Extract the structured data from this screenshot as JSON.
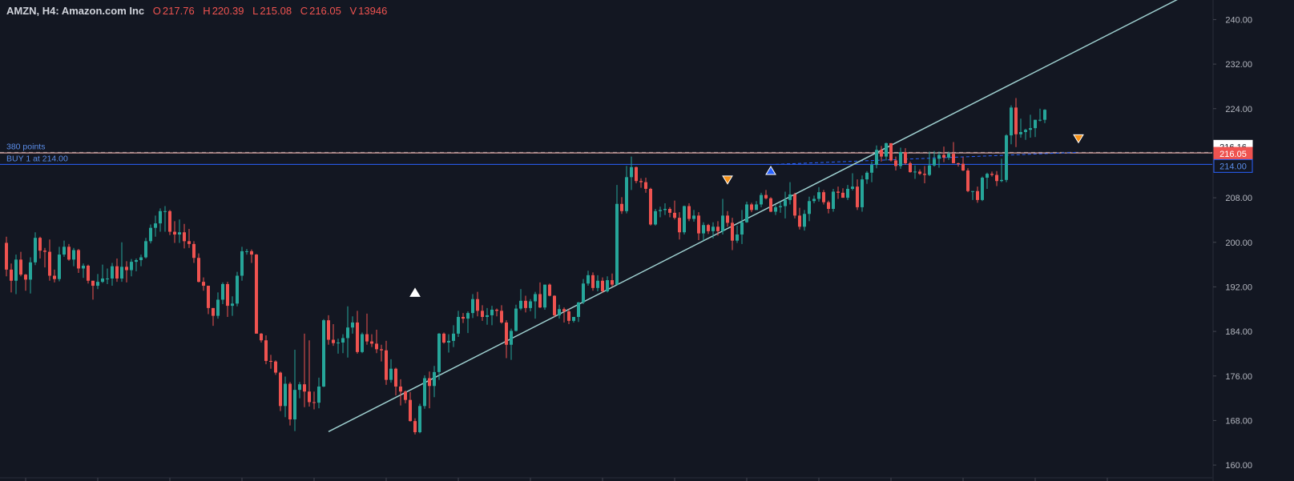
{
  "legend": {
    "symbol": "AMZN, H4: Amazon.com Inc",
    "o_label": "O",
    "o": "217.76",
    "h_label": "H",
    "h": "220.39",
    "l_label": "L",
    "l": "215.08",
    "c_label": "C",
    "c": "216.05",
    "v_label": "V",
    "v": "13946"
  },
  "colors": {
    "background": "#131722",
    "up": "#26a69a",
    "down": "#ef5350",
    "trendline": "#9ecfcf",
    "buy_line": "#2962ff",
    "last_price": "#ef5350",
    "text": "#d1d4dc",
    "axis_text": "#b2b5be",
    "signal_down": "#f7931a",
    "signal_up": "#2962ff"
  },
  "horizontal_lines": {
    "target": {
      "label": "380 points",
      "price": 216.16,
      "tag": "216.16"
    },
    "last": {
      "price": 216.05,
      "tag": "216.05"
    },
    "buy": {
      "label": "BUY 1 at 214.00",
      "price": 214.0,
      "tag": "214.00"
    }
  },
  "chart_data": {
    "type": "candlestick",
    "symbol": "AMZN",
    "timeframe": "H4",
    "ylim": [
      158,
      241.5
    ],
    "y_ticks": [
      "240.00",
      "232.00",
      "224.00",
      "216.00",
      "208.00",
      "200.00",
      "192.00",
      "184.00",
      "176.00",
      "168.00",
      "160.00"
    ],
    "bar_count": 226,
    "candles": [
      [
        199.9,
        201.0,
        193.9,
        195.1
      ],
      [
        195.1,
        196.2,
        191.0,
        193.1
      ],
      [
        193.1,
        197.8,
        190.7,
        196.9
      ],
      [
        196.9,
        198.3,
        193.9,
        194.2
      ],
      [
        194.2,
        194.3,
        191.3,
        193.3
      ],
      [
        193.3,
        197.3,
        190.8,
        196.4
      ],
      [
        196.4,
        201.8,
        195.9,
        200.8
      ],
      [
        200.8,
        201.0,
        197.1,
        198.5
      ],
      [
        198.5,
        199.0,
        195.5,
        198.3
      ],
      [
        198.3,
        200.5,
        193.1,
        194.0
      ],
      [
        194.0,
        195.1,
        192.8,
        193.4
      ],
      [
        193.4,
        199.2,
        193.0,
        197.8
      ],
      [
        197.8,
        200.3,
        197.4,
        199.2
      ],
      [
        199.2,
        199.7,
        196.7,
        196.9
      ],
      [
        196.9,
        199.0,
        195.7,
        198.6
      ],
      [
        198.6,
        198.8,
        194.5,
        195.3
      ],
      [
        195.3,
        196.2,
        193.6,
        195.8
      ],
      [
        195.8,
        196.0,
        192.6,
        193.1
      ],
      [
        193.1,
        193.1,
        189.7,
        192.2
      ],
      [
        192.2,
        194.3,
        191.6,
        192.9
      ],
      [
        192.9,
        196.0,
        192.7,
        193.5
      ],
      [
        193.5,
        195.3,
        192.5,
        193.5
      ],
      [
        193.5,
        196.3,
        192.2,
        195.7
      ],
      [
        195.7,
        197.1,
        192.9,
        193.5
      ],
      [
        193.5,
        200.0,
        192.9,
        195.6
      ],
      [
        195.6,
        196.6,
        192.8,
        195.0
      ],
      [
        195.0,
        197.0,
        193.9,
        196.5
      ],
      [
        196.5,
        197.1,
        194.8,
        196.8
      ],
      [
        196.8,
        197.8,
        195.7,
        197.3
      ],
      [
        197.3,
        200.8,
        197.1,
        200.2
      ],
      [
        200.2,
        203.2,
        199.8,
        202.6
      ],
      [
        202.6,
        204.8,
        201.0,
        203.4
      ],
      [
        203.4,
        206.1,
        201.9,
        205.6
      ],
      [
        205.6,
        206.5,
        201.9,
        205.6
      ],
      [
        205.6,
        205.8,
        201.3,
        201.9
      ],
      [
        201.9,
        203.8,
        199.9,
        201.4
      ],
      [
        201.4,
        204.1,
        199.9,
        201.8
      ],
      [
        201.8,
        203.3,
        198.9,
        200.2
      ],
      [
        200.2,
        202.4,
        199.0,
        199.7
      ],
      [
        199.7,
        200.2,
        196.3,
        197.2
      ],
      [
        197.2,
        198.0,
        192.8,
        192.9
      ],
      [
        192.9,
        193.7,
        191.3,
        192.2
      ],
      [
        192.2,
        192.2,
        187.1,
        188.2
      ],
      [
        188.2,
        188.2,
        185.0,
        186.8
      ],
      [
        186.8,
        191.0,
        186.3,
        189.7
      ],
      [
        189.7,
        192.8,
        188.9,
        192.5
      ],
      [
        192.5,
        192.9,
        186.6,
        188.6
      ],
      [
        188.6,
        190.3,
        186.8,
        189.0
      ],
      [
        189.0,
        194.7,
        188.5,
        194.0
      ],
      [
        194.0,
        199.2,
        193.1,
        198.4
      ],
      [
        198.4,
        198.8,
        197.8,
        198.4
      ],
      [
        198.4,
        198.7,
        196.3,
        197.8
      ],
      [
        197.8,
        197.9,
        183.6,
        183.6
      ],
      [
        183.6,
        183.7,
        182.0,
        182.4
      ],
      [
        182.4,
        183.3,
        178.1,
        178.7
      ],
      [
        178.7,
        179.8,
        177.3,
        178.6
      ],
      [
        178.6,
        178.8,
        176.2,
        176.6
      ],
      [
        176.6,
        176.8,
        169.7,
        170.6
      ],
      [
        170.6,
        175.9,
        168.6,
        174.6
      ],
      [
        174.6,
        174.9,
        167.1,
        168.2
      ],
      [
        168.2,
        180.7,
        166.1,
        173.5
      ],
      [
        173.5,
        174.9,
        172.0,
        174.5
      ],
      [
        174.5,
        183.6,
        170.4,
        173.2
      ],
      [
        173.2,
        182.4,
        170.5,
        171.3
      ],
      [
        171.3,
        173.2,
        170.0,
        171.2
      ],
      [
        171.2,
        175.7,
        170.2,
        174.1
      ],
      [
        174.1,
        186.2,
        174.0,
        186.0
      ],
      [
        186.0,
        186.9,
        181.6,
        182.5
      ],
      [
        182.5,
        185.3,
        181.4,
        181.9
      ],
      [
        181.9,
        182.7,
        180.0,
        182.0
      ],
      [
        182.0,
        183.5,
        180.1,
        182.8
      ],
      [
        182.8,
        188.5,
        179.3,
        184.7
      ],
      [
        184.7,
        186.7,
        183.6,
        185.6
      ],
      [
        185.6,
        187.7,
        180.0,
        180.3
      ],
      [
        180.3,
        183.8,
        180.1,
        183.5
      ],
      [
        183.5,
        187.2,
        181.6,
        182.2
      ],
      [
        182.2,
        183.5,
        181.2,
        181.8
      ],
      [
        181.8,
        184.3,
        180.1,
        180.8
      ],
      [
        180.8,
        181.6,
        178.6,
        180.6
      ],
      [
        180.6,
        182.3,
        174.4,
        175.3
      ],
      [
        175.3,
        179.0,
        174.8,
        177.3
      ],
      [
        177.3,
        177.5,
        172.5,
        174.1
      ],
      [
        174.1,
        175.4,
        170.7,
        173.2
      ],
      [
        173.2,
        173.4,
        171.1,
        171.7
      ],
      [
        171.7,
        173.1,
        167.8,
        167.9
      ],
      [
        167.9,
        168.4,
        165.5,
        165.9
      ],
      [
        165.9,
        171.0,
        165.7,
        170.6
      ],
      [
        170.6,
        176.1,
        170.1,
        175.6
      ],
      [
        175.6,
        176.8,
        170.2,
        174.2
      ],
      [
        174.2,
        177.8,
        172.2,
        176.7
      ],
      [
        176.7,
        183.7,
        175.3,
        183.6
      ],
      [
        183.6,
        183.8,
        181.8,
        182.0
      ],
      [
        182.0,
        183.5,
        180.2,
        182.3
      ],
      [
        182.3,
        185.1,
        181.2,
        183.6
      ],
      [
        183.6,
        187.7,
        183.0,
        186.6
      ],
      [
        186.6,
        187.3,
        185.5,
        186.3
      ],
      [
        186.3,
        187.6,
        183.7,
        187.3
      ],
      [
        187.3,
        190.7,
        186.4,
        189.8
      ],
      [
        189.8,
        191.1,
        186.7,
        187.7
      ],
      [
        187.7,
        188.7,
        185.9,
        186.6
      ],
      [
        186.6,
        188.2,
        185.2,
        186.9
      ],
      [
        186.9,
        188.6,
        185.1,
        187.9
      ],
      [
        187.9,
        188.1,
        186.7,
        187.7
      ],
      [
        187.7,
        188.7,
        185.4,
        185.6
      ],
      [
        185.6,
        186.0,
        179.2,
        181.6
      ],
      [
        181.6,
        184.5,
        178.9,
        184.1
      ],
      [
        184.1,
        188.8,
        184.0,
        188.1
      ],
      [
        188.1,
        191.6,
        187.8,
        189.5
      ],
      [
        189.5,
        190.4,
        187.4,
        188.2
      ],
      [
        188.2,
        189.8,
        187.6,
        189.4
      ],
      [
        189.4,
        191.1,
        186.3,
        190.7
      ],
      [
        190.7,
        192.8,
        188.2,
        188.3
      ],
      [
        188.3,
        192.4,
        187.9,
        192.4
      ],
      [
        192.4,
        192.6,
        190.3,
        190.4
      ],
      [
        190.4,
        190.5,
        186.6,
        186.9
      ],
      [
        186.9,
        188.8,
        186.3,
        188.0
      ],
      [
        188.0,
        188.3,
        185.6,
        187.6
      ],
      [
        187.6,
        188.1,
        185.3,
        185.9
      ],
      [
        185.9,
        186.6,
        185.6,
        186.6
      ],
      [
        186.6,
        189.3,
        185.7,
        189.2
      ],
      [
        189.2,
        193.4,
        188.9,
        192.6
      ],
      [
        192.6,
        194.9,
        192.2,
        194.1
      ],
      [
        194.1,
        194.6,
        191.3,
        191.8
      ],
      [
        191.8,
        194.1,
        191.2,
        193.1
      ],
      [
        193.1,
        193.7,
        190.9,
        191.2
      ],
      [
        191.2,
        193.9,
        191.0,
        193.2
      ],
      [
        193.2,
        194.4,
        192.0,
        192.4
      ],
      [
        192.4,
        210.3,
        205.3,
        206.9
      ],
      [
        206.9,
        208.1,
        205.1,
        205.6
      ],
      [
        205.6,
        213.7,
        205.2,
        211.7
      ],
      [
        211.7,
        215.4,
        209.4,
        213.5
      ],
      [
        213.5,
        213.6,
        210.6,
        211.0
      ],
      [
        211.0,
        211.5,
        209.8,
        210.8
      ],
      [
        210.8,
        211.6,
        208.9,
        209.6
      ],
      [
        209.6,
        209.8,
        203.0,
        203.2
      ],
      [
        203.2,
        206.0,
        203.0,
        205.6
      ],
      [
        205.6,
        206.4,
        204.5,
        205.8
      ],
      [
        205.8,
        207.0,
        204.9,
        206.0
      ],
      [
        206.0,
        206.3,
        204.5,
        205.3
      ],
      [
        205.3,
        207.5,
        204.1,
        204.4
      ],
      [
        204.4,
        205.4,
        200.5,
        201.8
      ],
      [
        201.8,
        206.6,
        201.4,
        206.5
      ],
      [
        206.5,
        207.0,
        203.8,
        204.2
      ],
      [
        204.2,
        205.8,
        203.7,
        204.8
      ],
      [
        204.8,
        205.4,
        200.4,
        201.6
      ],
      [
        201.6,
        203.6,
        200.3,
        203.1
      ],
      [
        203.1,
        203.3,
        201.5,
        202.0
      ],
      [
        202.0,
        203.6,
        200.7,
        202.8
      ],
      [
        202.8,
        203.8,
        201.2,
        202.0
      ],
      [
        202.0,
        207.8,
        201.4,
        204.8
      ],
      [
        204.8,
        205.6,
        202.8,
        203.5
      ],
      [
        203.5,
        204.4,
        198.6,
        200.3
      ],
      [
        200.3,
        203.0,
        199.9,
        201.4
      ],
      [
        201.4,
        205.8,
        199.7,
        203.6
      ],
      [
        203.6,
        207.3,
        203.5,
        206.8
      ],
      [
        206.8,
        207.1,
        205.4,
        205.8
      ],
      [
        205.8,
        207.4,
        206.0,
        206.8
      ],
      [
        206.8,
        208.9,
        206.3,
        208.5
      ],
      [
        208.5,
        209.4,
        207.7,
        207.9
      ],
      [
        207.9,
        208.1,
        205.4,
        205.5
      ],
      [
        205.5,
        206.7,
        204.9,
        206.3
      ],
      [
        206.3,
        207.3,
        205.3,
        206.5
      ],
      [
        206.5,
        209.1,
        204.3,
        207.6
      ],
      [
        207.6,
        210.8,
        206.8,
        208.6
      ],
      [
        208.6,
        208.9,
        204.3,
        204.8
      ],
      [
        204.8,
        206.2,
        202.3,
        202.8
      ],
      [
        202.8,
        205.8,
        202.1,
        205.1
      ],
      [
        205.1,
        208.2,
        203.8,
        207.4
      ],
      [
        207.4,
        208.4,
        207.0,
        207.8
      ],
      [
        207.8,
        209.9,
        207.3,
        209.0
      ],
      [
        209.0,
        209.4,
        206.8,
        207.2
      ],
      [
        207.2,
        207.5,
        205.2,
        206.0
      ],
      [
        206.0,
        209.6,
        205.5,
        209.1
      ],
      [
        209.1,
        210.0,
        207.8,
        208.9
      ],
      [
        208.9,
        209.7,
        208.0,
        208.0
      ],
      [
        208.0,
        210.3,
        207.6,
        209.6
      ],
      [
        209.6,
        212.4,
        209.3,
        210.0
      ],
      [
        210.0,
        211.3,
        205.8,
        206.3
      ],
      [
        206.3,
        212.0,
        205.5,
        211.3
      ],
      [
        211.3,
        212.8,
        210.5,
        212.5
      ],
      [
        212.5,
        214.5,
        210.8,
        213.9
      ],
      [
        213.9,
        217.4,
        213.3,
        216.6
      ],
      [
        216.6,
        217.3,
        214.5,
        215.4
      ],
      [
        215.4,
        217.9,
        214.7,
        217.8
      ],
      [
        217.8,
        217.8,
        214.5,
        214.7
      ],
      [
        214.7,
        215.4,
        212.9,
        213.7
      ],
      [
        213.7,
        217.0,
        213.2,
        216.2
      ],
      [
        216.2,
        216.9,
        213.9,
        214.2
      ],
      [
        214.2,
        214.5,
        212.5,
        212.6
      ],
      [
        212.6,
        213.8,
        211.4,
        212.7
      ],
      [
        212.7,
        213.1,
        212.1,
        212.3
      ],
      [
        212.3,
        213.7,
        210.6,
        212.1
      ],
      [
        212.1,
        216.3,
        211.9,
        213.8
      ],
      [
        213.8,
        216.4,
        213.6,
        215.0
      ],
      [
        215.0,
        216.3,
        213.4,
        215.7
      ],
      [
        215.7,
        217.2,
        214.4,
        215.2
      ],
      [
        215.2,
        216.3,
        214.8,
        215.9
      ],
      [
        215.9,
        218.0,
        215.4,
        214.2
      ],
      [
        214.2,
        214.3,
        213.6,
        214.1
      ],
      [
        214.1,
        215.3,
        212.8,
        212.9
      ],
      [
        212.9,
        213.3,
        209.0,
        209.2
      ],
      [
        209.2,
        209.2,
        207.6,
        209.2
      ],
      [
        209.2,
        210.0,
        207.1,
        207.6
      ],
      [
        207.6,
        211.8,
        207.4,
        211.6
      ],
      [
        211.6,
        212.5,
        209.6,
        212.3
      ],
      [
        212.3,
        212.7,
        211.8,
        212.1
      ],
      [
        212.1,
        212.8,
        210.1,
        211.0
      ],
      [
        211.0,
        215.0,
        210.8,
        211.2
      ],
      [
        211.2,
        219.4,
        210.8,
        219.2
      ],
      [
        219.2,
        224.6,
        217.6,
        224.2
      ],
      [
        224.2,
        225.9,
        217.1,
        219.4
      ],
      [
        219.4,
        222.2,
        218.8,
        219.8
      ],
      [
        219.8,
        220.4,
        218.4,
        220.2
      ],
      [
        220.2,
        222.9,
        218.8,
        220.5
      ],
      [
        220.5,
        222.0,
        218.9,
        222.0
      ],
      [
        222.0,
        224.0,
        221.7,
        222.0
      ],
      [
        222.0,
        223.9,
        221.4,
        223.8
      ]
    ]
  }
}
